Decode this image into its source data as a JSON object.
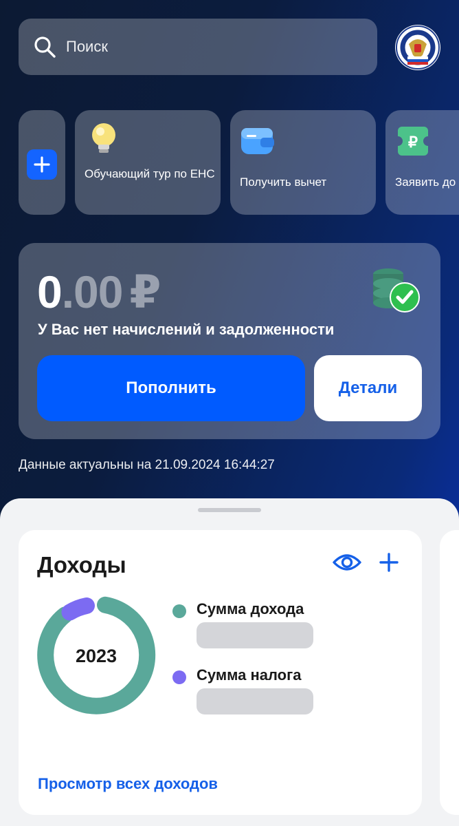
{
  "search": {
    "placeholder": "Поиск"
  },
  "quick_actions": [
    {
      "label": "Обучающий тур по ЕНС",
      "icon": "lightbulb-icon"
    },
    {
      "label": "Получить вычет",
      "icon": "wallet-icon"
    },
    {
      "label": "Заявить до",
      "icon": "ruble-ticket-icon"
    }
  ],
  "balance": {
    "integer": "0",
    "decimal": ".00",
    "currency": "₽",
    "status": "У Вас нет начислений и задолженности",
    "topup_label": "Пополнить",
    "details_label": "Детали"
  },
  "updated_text": "Данные актуальны на 21.09.2024 16:44:27",
  "income": {
    "title": "Доходы",
    "year": "2023",
    "legend": [
      {
        "label": "Сумма дохода",
        "color": "#5aa89a"
      },
      {
        "label": "Сумма налога",
        "color": "#7c6bf2"
      }
    ],
    "view_all_label": "Просмотр всех доходов"
  },
  "colors": {
    "accent": "#005bff",
    "link": "#1560e8",
    "income": "#5aa89a",
    "tax": "#7c6bf2"
  }
}
